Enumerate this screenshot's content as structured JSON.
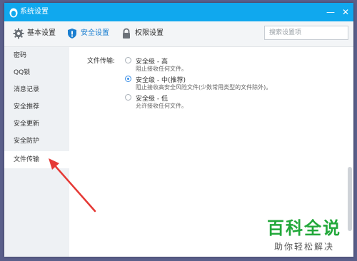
{
  "window": {
    "title": "系统设置"
  },
  "titlebar": {
    "minimize": "—",
    "close": "✕"
  },
  "tabs": [
    {
      "label": "基本设置",
      "icon": "gear-icon"
    },
    {
      "label": "安全设置",
      "icon": "shield-icon"
    },
    {
      "label": "权限设置",
      "icon": "lock-icon"
    }
  ],
  "search": {
    "placeholder": "搜索设置项",
    "value": ""
  },
  "sidebar": {
    "items": [
      {
        "label": "密码"
      },
      {
        "label": "QQ锁"
      },
      {
        "label": "消息记录"
      },
      {
        "label": "安全推荐"
      },
      {
        "label": "安全更新"
      },
      {
        "label": "安全防护"
      },
      {
        "label": "文件传输"
      }
    ],
    "active": "文件传输"
  },
  "content": {
    "field_label": "文件传输:",
    "options": [
      {
        "title": "安全级 - 高",
        "desc": "阻止接收任何文件。",
        "selected": false
      },
      {
        "title": "安全级 - 中(推荐)",
        "desc": "阻止接收高安全风险文件(少数常用类型的文件除外)。",
        "selected": true
      },
      {
        "title": "安全级 - 低",
        "desc": "允许接收任何文件。",
        "selected": false
      }
    ]
  },
  "colors": {
    "titlebar": "#10a8ee",
    "accent": "#1b7fd0",
    "annotation_arrow": "#e53935",
    "watermark": "#22a83a"
  },
  "watermark": {
    "big": "百科全说",
    "small": "助你轻松解决"
  }
}
